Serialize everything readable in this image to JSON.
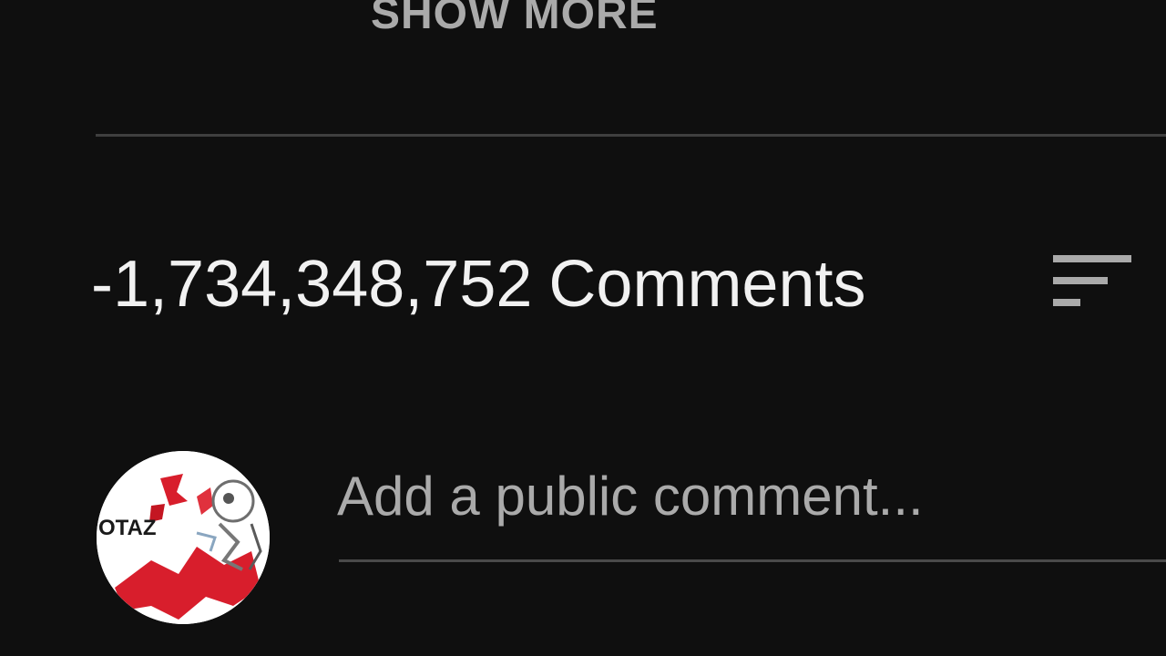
{
  "description": {
    "show_more_label": "SHOW MORE"
  },
  "comments": {
    "count": "-1,734,348,752",
    "label": "Comments",
    "sort_icon": "sort-icon",
    "input": {
      "placeholder": "Add a public comment..."
    },
    "avatar": {
      "text": "OTAZ"
    }
  },
  "colors": {
    "background": "#0f0f0f",
    "text_primary": "#f1f1f1",
    "text_secondary": "#aaaaaa",
    "divider": "#3f3f3f",
    "avatar_accent": "#d81e2c"
  }
}
